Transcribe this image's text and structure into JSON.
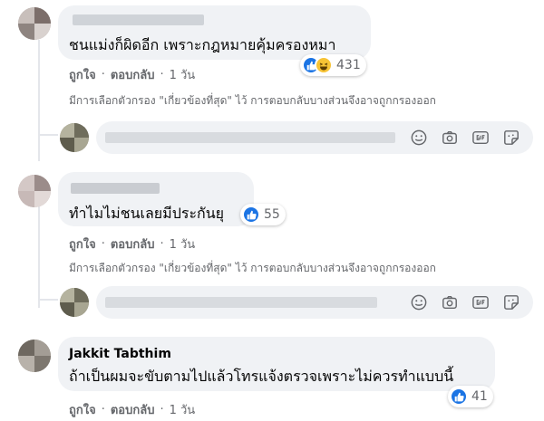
{
  "comments": [
    {
      "name": "",
      "text": "ชนแม่งก็ผิดอีก เพราะกฎหมายคุ้มครองหมา",
      "reactions": {
        "icons": [
          "like-icon",
          "haha-icon"
        ],
        "count": "431"
      },
      "actions": {
        "like": "ถูกใจ",
        "reply": "ตอบกลับ",
        "time": "1 วัน"
      },
      "filter_note": "มีการเลือกตัวกรอง \"เกี่ยวข้องที่สุด\" ไว้ การตอบกลับบางส่วนจึงอาจถูกกรองออก"
    },
    {
      "name": "",
      "text": "ทำไมไม่ชนเลยมีประกันยุ",
      "reactions": {
        "icons": [
          "like-icon"
        ],
        "count": "55"
      },
      "actions": {
        "like": "ถูกใจ",
        "reply": "ตอบกลับ",
        "time": "1 วัน"
      },
      "filter_note": "มีการเลือกตัวกรอง \"เกี่ยวข้องที่สุด\" ไว้ การตอบกลับบางส่วนจึงอาจถูกกรองออก"
    },
    {
      "name": "Jakkit Tabthim",
      "text": "ถ้าเป็นผมจะขับตามไปแล้วโทรแจ้งตรวจเพราะไม่ควรทำแบบนี้",
      "reactions": {
        "icons": [
          "like-icon"
        ],
        "count": "41"
      },
      "actions": {
        "like": "ถูกใจ",
        "reply": "ตอบกลับ",
        "time": "1 วัน"
      }
    }
  ],
  "reply_tools": [
    "smiley-icon",
    "camera-icon",
    "gif-icon",
    "sticker-icon"
  ],
  "colors": {
    "like_blue": "#1b74e4",
    "haha_yellow": "#f7c335",
    "bubble_bg": "#f0f2f5",
    "secondary_text": "#65676b"
  }
}
